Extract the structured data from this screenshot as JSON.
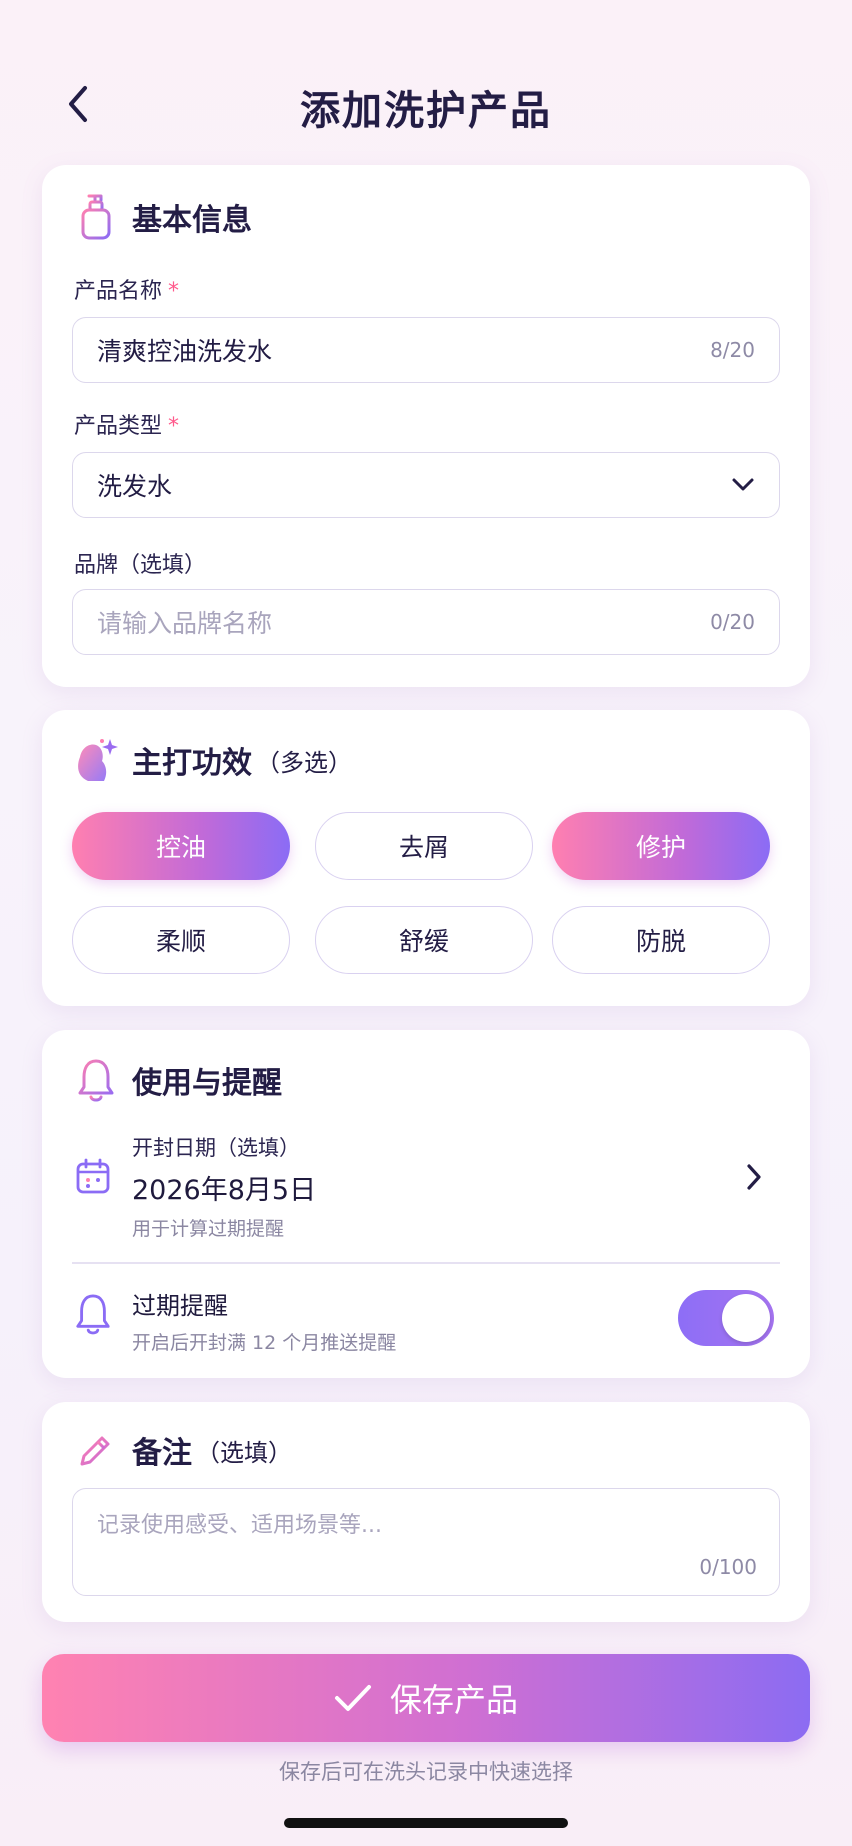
{
  "header": {
    "title": "添加洗护产品"
  },
  "basic": {
    "title": "基本信息",
    "name_label": "产品名称",
    "required_mark": "*",
    "name_value": "清爽控油洗发水",
    "name_count": "8/20",
    "type_label": "产品类型",
    "type_value": "洗发水",
    "brand_label": "品牌（选填）",
    "brand_placeholder": "请输入品牌名称",
    "brand_count": "0/20"
  },
  "effects": {
    "title": "主打功效",
    "title_sub": "（多选）",
    "chips": [
      {
        "label": "控油",
        "selected": true
      },
      {
        "label": "去屑",
        "selected": false
      },
      {
        "label": "修护",
        "selected": true
      },
      {
        "label": "柔顺",
        "selected": false
      },
      {
        "label": "舒缓",
        "selected": false
      },
      {
        "label": "防脱",
        "selected": false
      }
    ]
  },
  "usage": {
    "title": "使用与提醒",
    "open_date_label": "开封日期（选填）",
    "open_date_value": "2026年8月5日",
    "open_date_note": "用于计算过期提醒",
    "expiry_label": "过期提醒",
    "expiry_note": "开启后开封满 12 个月推送提醒",
    "expiry_enabled": true
  },
  "notes": {
    "title": "备注",
    "title_sub": "（选填）",
    "placeholder": "记录使用感受、适用场景等...",
    "count": "0/100"
  },
  "footer": {
    "save_label": "保存产品",
    "hint": "保存后可在洗头记录中快速选择"
  },
  "colors": {
    "accent_pink": "#ff7fb0",
    "accent_purple": "#8b6cf5",
    "text_dark": "#231d45"
  }
}
